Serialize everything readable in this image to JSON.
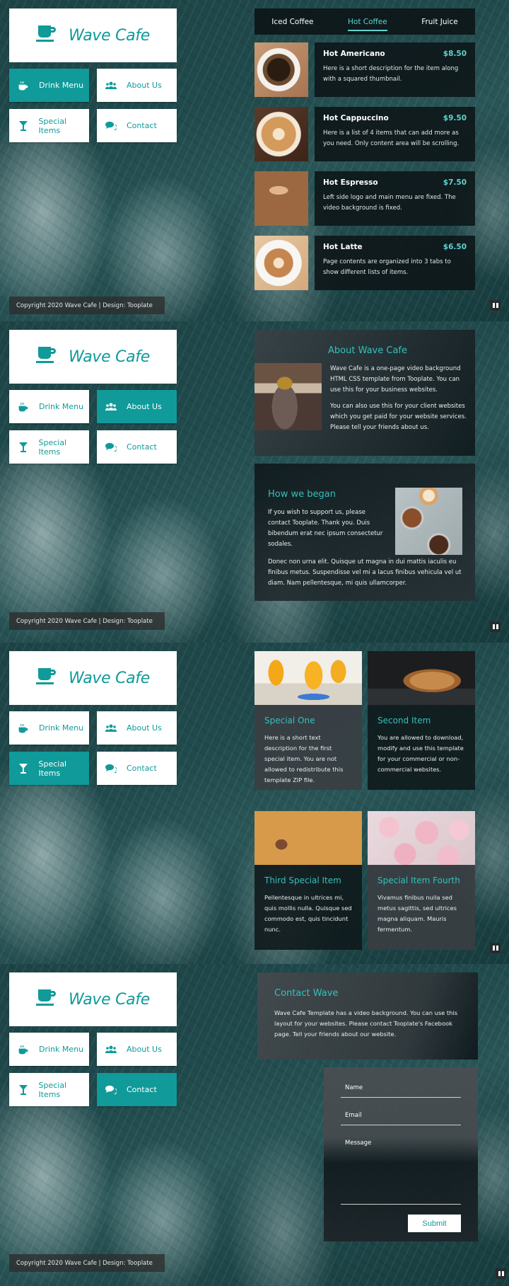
{
  "brand": {
    "name": "Wave Cafe",
    "icon": "coffee-cup-icon",
    "accent_color": "#109a9a",
    "highlight_color": "#5fd3cf"
  },
  "nav": {
    "items": [
      {
        "label": "Drink Menu",
        "icon": "hot-coffee-icon"
      },
      {
        "label": "About Us",
        "icon": "users-icon"
      },
      {
        "label": "Special Items",
        "icon": "cocktail-glass-icon"
      },
      {
        "label": "Contact",
        "icon": "comments-icon"
      }
    ]
  },
  "footer": {
    "copyright": "Copyright 2020 Wave Cafe | Design: Tooplate"
  },
  "video_control": {
    "icon": "pause-icon"
  },
  "screens": [
    {
      "active_nav": "Drink Menu",
      "tabs": [
        {
          "label": "Iced Coffee",
          "active": false
        },
        {
          "label": "Hot Coffee",
          "active": true
        },
        {
          "label": "Fruit Juice",
          "active": false
        }
      ],
      "menu_items": [
        {
          "name": "Hot Americano",
          "price": "$8.50",
          "description": "Here is a short description for the item along with a squared thumbnail."
        },
        {
          "name": "Hot Cappuccino",
          "price": "$9.50",
          "description": "Here is a list of 4 items that can add more as you need. Only content area will be scrolling."
        },
        {
          "name": "Hot Espresso",
          "price": "$7.50",
          "description": "Left side logo and main menu are fixed. The video background is fixed."
        },
        {
          "name": "Hot Latte",
          "price": "$6.50",
          "description": "Page contents are organized into 3 tabs to show different lists of items."
        }
      ]
    },
    {
      "active_nav": "About Us",
      "about": {
        "title": "About Wave Cafe",
        "paragraphs": [
          "Wave Cafe is a one-page video background HTML CSS template from Tooplate. You can use this for your business websites.",
          "You can also use this for your client websites which you get paid for your website services. Please tell your friends about us."
        ]
      },
      "began": {
        "title": "How we began",
        "paragraphs": [
          "If you wish to support us, please contact Tooplate. Thank you. Duis bibendum erat nec ipsum consectetur sodales.",
          "Donec non urna elit. Quisque ut magna in dui mattis iaculis eu finibus metus. Suspendisse vel mi a lacus finibus vehicula vel ut diam. Nam pellentesque, mi quis ullamcorper."
        ]
      }
    },
    {
      "active_nav": "Special Items",
      "specials": [
        {
          "title": "Special One",
          "description": "Here is a short text description for the first special item. You are not allowed to redistribute this template ZIP file."
        },
        {
          "title": "Second Item",
          "description": "You are allowed to download, modify and use this template for your commercial or non-commercial websites."
        },
        {
          "title": "Third Special Item",
          "description": "Pellentesque in ultrices mi, quis mollis nulla. Quisque sed commodo est, quis tincidunt nunc."
        },
        {
          "title": "Special Item Fourth",
          "description": "Vivamus finibus nulla sed metus sagittis, sed ultrices magna aliquam. Mauris fermentum."
        }
      ]
    },
    {
      "active_nav": "Contact",
      "contact": {
        "title": "Contact Wave",
        "text": "Wave Cafe Template has a video background. You can use this layout for your websites. Please contact Tooplate's Facebook page. Tell your friends about our website."
      },
      "form": {
        "name_placeholder": "Name",
        "email_placeholder": "Email",
        "message_placeholder": "Message",
        "name_value": "",
        "email_value": "",
        "message_value": "",
        "submit_label": "Submit"
      }
    }
  ]
}
